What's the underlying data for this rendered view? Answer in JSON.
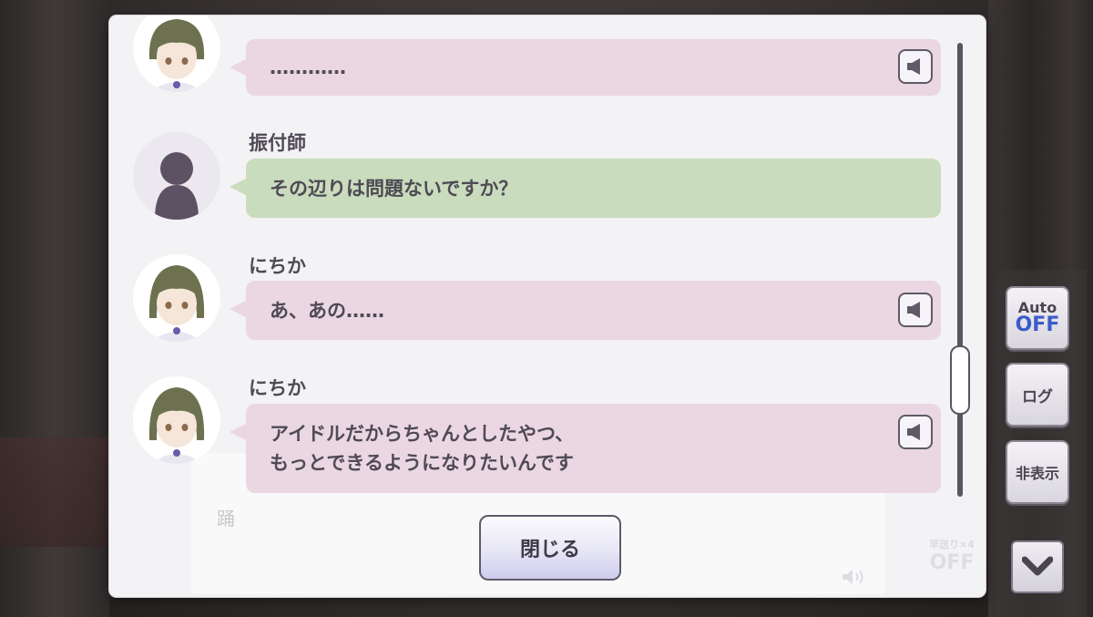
{
  "log": {
    "messages": [
      {
        "speaker": "",
        "text": "…………",
        "color": "pink",
        "avatar": "nichika-icon",
        "has_voice": true
      },
      {
        "speaker": "振付師",
        "text": "その辺りは問題ないですか？",
        "color": "green",
        "avatar": "silhouette-icon",
        "has_voice": false
      },
      {
        "speaker": "にちか",
        "text": "あ、あの……",
        "color": "pink",
        "avatar": "nichika-icon",
        "has_voice": true
      },
      {
        "speaker": "にちか",
        "text": "アイドルだからちゃんとしたやつ、\nもっとできるようになりたいんです",
        "color": "pink",
        "avatar": "nichika-icon",
        "has_voice": true
      }
    ],
    "close_label": "閉じる"
  },
  "controls": {
    "auto_label": "Auto",
    "auto_state": "OFF",
    "log_label": "ログ",
    "hide_label": "非表示"
  },
  "background_text": {
    "dance_char": "踊",
    "fast_forward_label": "早送り×4",
    "fast_forward_state": "OFF"
  },
  "colors": {
    "pink_bubble": "#ead7e1",
    "green_bubble": "#c9dcbd",
    "auto_off": "#3b5cc8"
  }
}
